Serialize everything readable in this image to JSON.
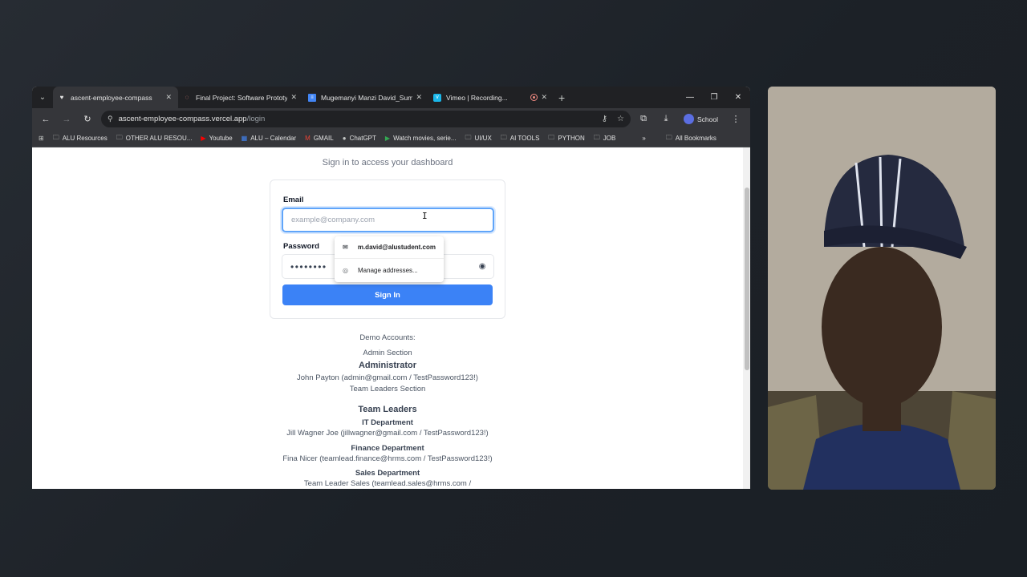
{
  "tabs": [
    {
      "title": "ascent-employee-compass",
      "active": true
    },
    {
      "title": "Final Project: Software Prototype",
      "active": false
    },
    {
      "title": "Mugemanyi Manzi David_Summ",
      "active": false
    },
    {
      "title": "Vimeo | Recording...",
      "active": false
    }
  ],
  "address": {
    "host": "ascent-employee-compass.vercel.app",
    "path": "/login"
  },
  "profile": {
    "label": "School"
  },
  "bookmarks": [
    "ALU Resources",
    "OTHER ALU RESOU...",
    "Youtube",
    "ALU – Calendar",
    "GMAIL",
    "ChatGPT",
    "Watch movies, serie...",
    "UI/UX",
    "AI TOOLS",
    "PYTHON",
    "JOB"
  ],
  "all_bookmarks": "All Bookmarks",
  "page": {
    "subtitle": "Sign in to access your dashboard",
    "email_label": "Email",
    "email_placeholder": "example@company.com",
    "password_label": "Password",
    "password_value": "••••••••",
    "signin_label": "Sign In"
  },
  "autofill": {
    "suggestion": "m.david@alustudent.com",
    "manage": "Manage addresses..."
  },
  "demo": {
    "heading": "Demo Accounts:",
    "admin_section": "Admin Section",
    "admin_title": "Administrator",
    "admin_account": "John Payton (admin@gmail.com / TestPassword123!)",
    "team_section": "Team Leaders Section",
    "team_title": "Team Leaders",
    "it_dept": "IT Department",
    "it_account": "Jill Wagner Joe (jillwagner@gmail.com / TestPassword123!)",
    "finance_dept": "Finance Department",
    "finance_account": "Fina Nicer (teamlead.finance@hrms.com / TestPassword123!)",
    "sales_dept": "Sales Department",
    "sales_account": "Team Leader Sales (teamlead.sales@hrms.com /"
  },
  "colors": {
    "accent": "#3b82f6",
    "focus": "#60a5fa",
    "chrome_dark": "#202124",
    "chrome_mid": "#35363a"
  }
}
